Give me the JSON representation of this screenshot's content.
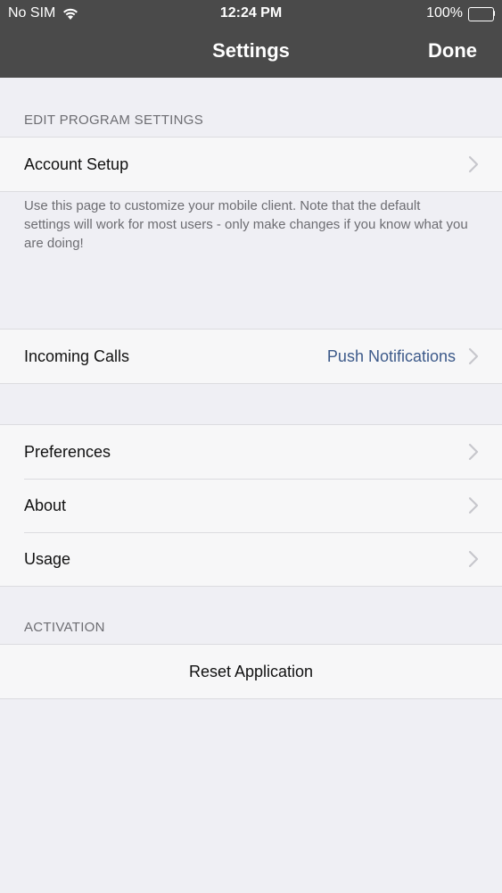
{
  "status_bar": {
    "carrier": "No SIM",
    "time": "12:24 PM",
    "battery": "100%"
  },
  "nav": {
    "title": "Settings",
    "done_label": "Done"
  },
  "sections": {
    "edit_program": {
      "header": "EDIT PROGRAM SETTINGS",
      "account_setup_label": "Account Setup",
      "footer": "Use this page to customize your mobile client. Note that the default settings will work for most users - only make changes if you know what you are doing!"
    },
    "calls": {
      "incoming_calls_label": "Incoming Calls",
      "incoming_calls_value": "Push Notifications"
    },
    "general": {
      "items": [
        {
          "label": "Preferences"
        },
        {
          "label": "About"
        },
        {
          "label": "Usage"
        }
      ]
    },
    "activation": {
      "header": "ACTIVATION",
      "reset_label": "Reset Application"
    }
  },
  "colors": {
    "nav_background": "#4a4a4a",
    "page_background": "#efeff4",
    "value_blue": "#3d5a8a"
  }
}
